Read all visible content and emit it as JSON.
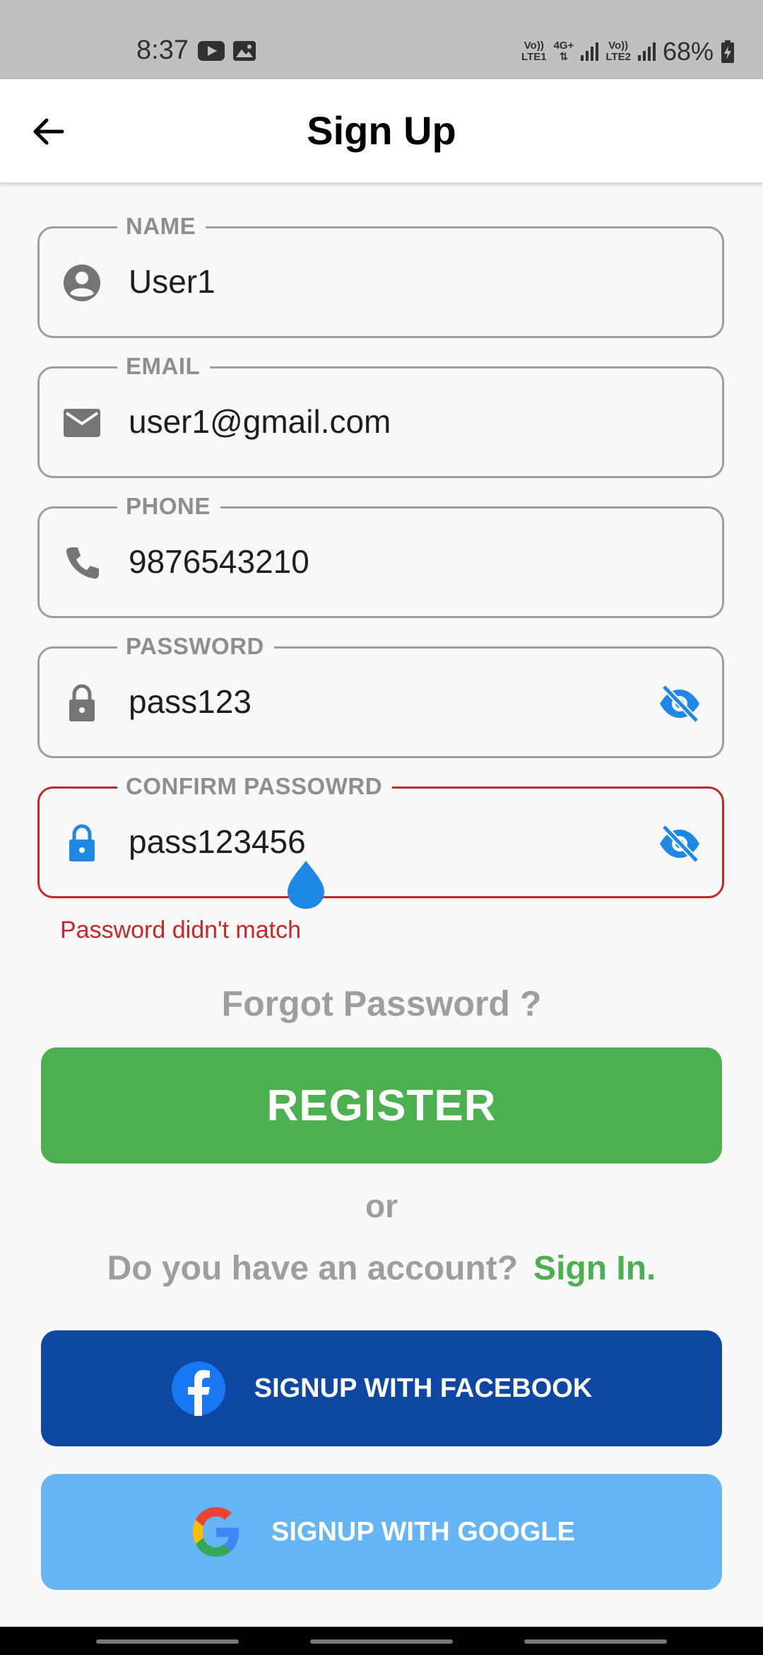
{
  "status_bar": {
    "time": "8:37",
    "sim1_label_top": "Vo))",
    "sim1_label_bottom": "LTE1",
    "net_label_top": "4G+",
    "sim2_label_top": "Vo))",
    "sim2_label_bottom": "LTE2",
    "battery": "68%"
  },
  "app_bar": {
    "title": "Sign Up"
  },
  "fields": {
    "name": {
      "label": "NAME",
      "value": "User1"
    },
    "email": {
      "label": "EMAIL",
      "value": "user1@gmail.com"
    },
    "phone": {
      "label": "PHONE",
      "value": "9876543210"
    },
    "password": {
      "label": "PASSWORD",
      "value": "pass123"
    },
    "confirm": {
      "label": "CONFIRM PASSOWRD",
      "value": "pass123456",
      "error": "Password didn't match"
    }
  },
  "forgot_label": "Forgot Password ?",
  "register_label": "REGISTER",
  "or_label": "or",
  "account_prompt": "Do you have an account?",
  "signin_label": "Sign In.",
  "facebook_label": "SIGNUP WITH FACEBOOK",
  "google_label": "SIGNUP WITH GOOGLE",
  "colors": {
    "accent_green": "#4caf50",
    "facebook_blue": "#0d47a1",
    "google_light_blue": "#64b5f6",
    "error_red": "#c62828",
    "focus_blue": "#1e88e5"
  }
}
